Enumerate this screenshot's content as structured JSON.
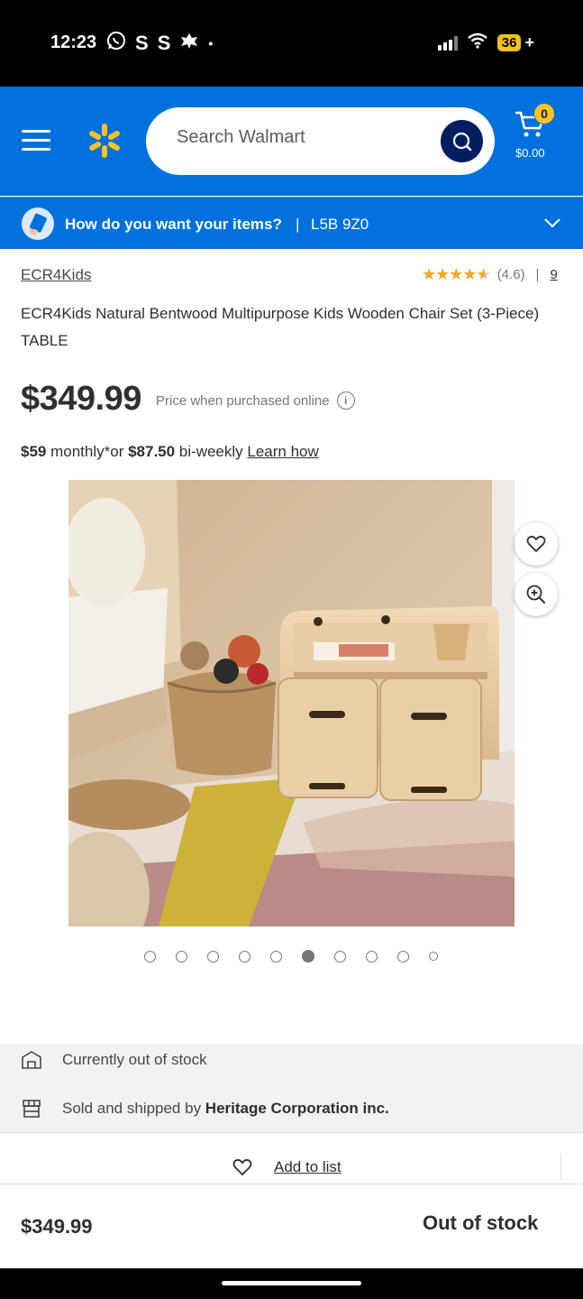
{
  "status_bar": {
    "time": "12:23",
    "notif_icons": [
      "whatsapp-icon",
      "S",
      "S",
      "leaf-icon",
      "•"
    ],
    "battery": "36"
  },
  "header": {
    "search_placeholder": "Search Walmart",
    "cart_count": "0",
    "cart_total": "$0.00",
    "brand_color": "#0071dc",
    "spark_color": "#ffc220"
  },
  "delivery": {
    "prompt": "How do you want your items?",
    "separator": "|",
    "zip": "L5B 9Z0"
  },
  "product": {
    "brand": "ECR4Kids",
    "rating": "(4.6)",
    "rating_value": 4.6,
    "rating_sep": "|",
    "review_count": "9",
    "title": "ECR4Kids Natural Bentwood Multipurpose Kids Wooden Chair Set (3-Piece) TABLE",
    "price": "$349.99",
    "price_note": "Price when purchased online",
    "monthly_amount": "$59",
    "monthly_text": " monthly*or ",
    "biweekly_amount": "$87.50",
    "biweekly_text": " bi-weekly ",
    "learn_how": "Learn how"
  },
  "gallery": {
    "dot_count": 10,
    "active_index": 5
  },
  "availability": {
    "stock_text": "Currently out of stock",
    "sold_by_prefix": "Sold and shipped by ",
    "seller": "Heritage Corporation inc."
  },
  "add_to_list": "Add to list",
  "bottom_bar": {
    "price": "$349.99",
    "status": "Out of stock"
  }
}
